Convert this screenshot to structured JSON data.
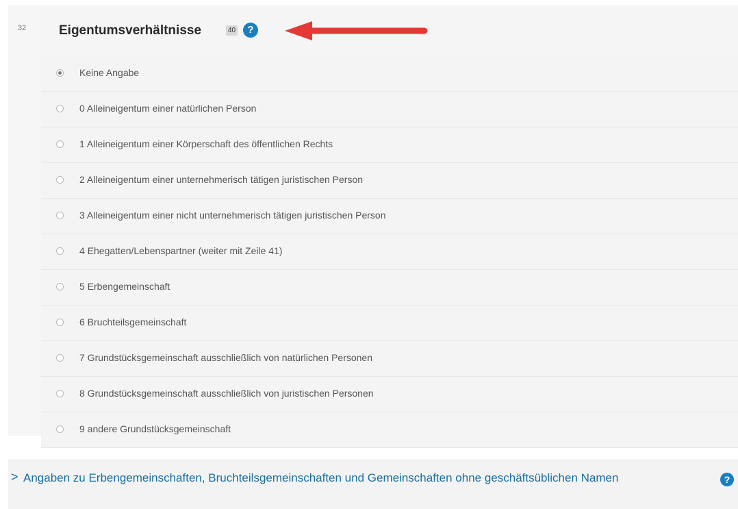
{
  "question": {
    "line_number": "32",
    "title": "Eigentumsverhältnisse",
    "badge": "40",
    "help_glyph": "?",
    "annotation_color": "#e53935",
    "options": [
      {
        "label": "Keine Angabe",
        "checked": true
      },
      {
        "label": "0 Alleineigentum einer natürlichen Person",
        "checked": false
      },
      {
        "label": "1 Alleineigentum einer Körperschaft des öffentlichen Rechts",
        "checked": false
      },
      {
        "label": "2 Alleineigentum einer unternehmerisch tätigen juristischen Person",
        "checked": false
      },
      {
        "label": "3 Alleineigentum einer nicht unternehmerisch tätigen juristischen Person",
        "checked": false
      },
      {
        "label": "4 Ehegatten/Lebenspartner (weiter mit Zeile 41)",
        "checked": false
      },
      {
        "label": "5 Erbengemeinschaft",
        "checked": false
      },
      {
        "label": "6 Bruchteilsgemeinschaft",
        "checked": false
      },
      {
        "label": "7 Grundstücksgemeinschaft ausschließlich von natürlichen Personen",
        "checked": false
      },
      {
        "label": "8 Grundstücksgemeinschaft ausschließlich von juristischen Personen",
        "checked": false
      },
      {
        "label": "9 andere Grundstücksgemeinschaft",
        "checked": false
      }
    ]
  },
  "section": {
    "chevron": ">",
    "title": "Angaben zu Erbengemeinschaften, Bruchteilsgemeinschaften und Gemeinschaften ohne geschäftsüblichen Namen",
    "help_glyph": "?",
    "accent_color": "#1a6f9e"
  }
}
